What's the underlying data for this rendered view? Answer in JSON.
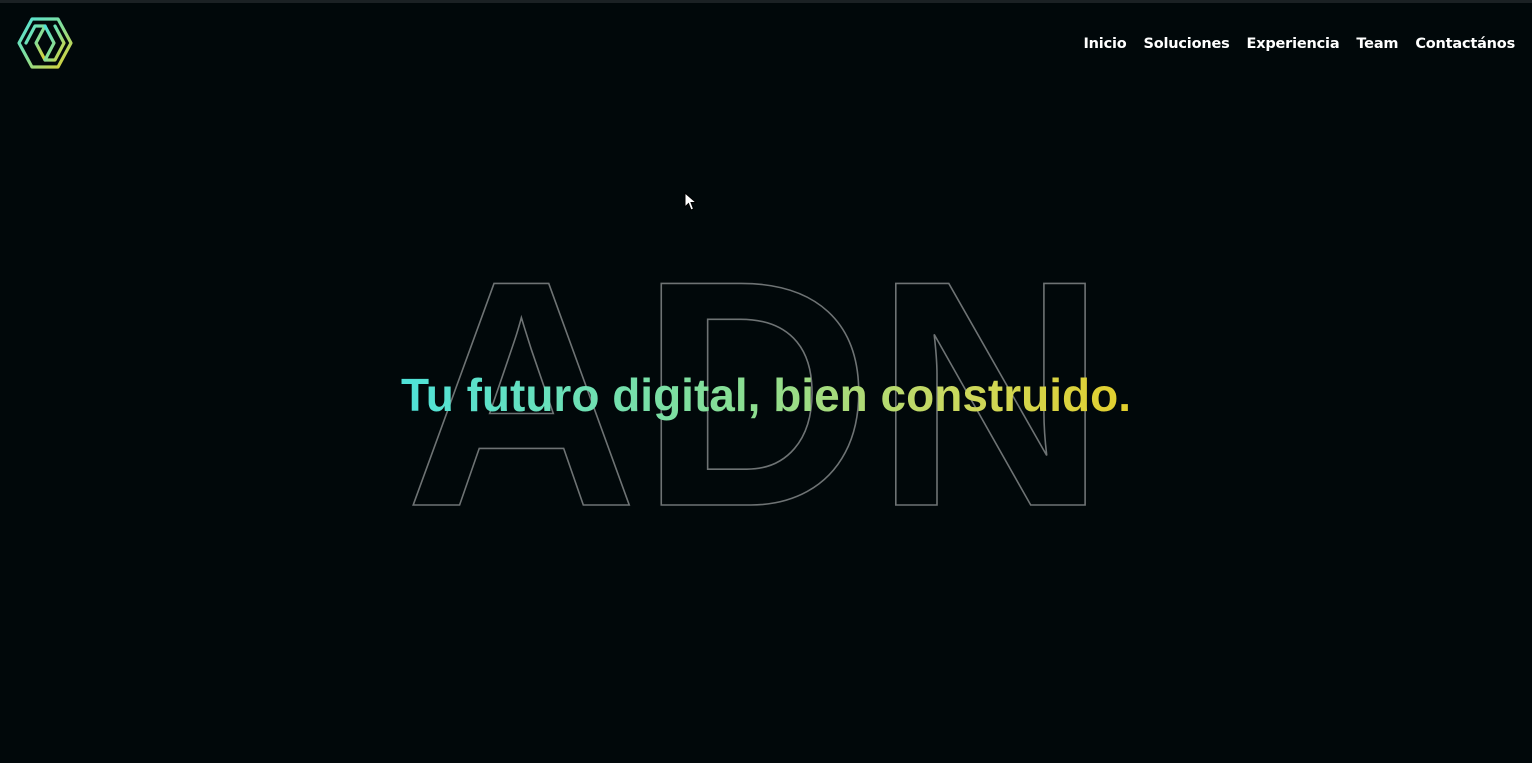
{
  "brand": {
    "logo_icon": "adn-hexagon-logo-icon",
    "gradient_colors": [
      "#4fe2d9",
      "#86de96",
      "#c9d860",
      "#e3cf2c"
    ]
  },
  "nav": {
    "items": [
      {
        "label": "Inicio"
      },
      {
        "label": "Soluciones"
      },
      {
        "label": "Experiencia"
      },
      {
        "label": "Team"
      },
      {
        "label": "Contactános"
      }
    ]
  },
  "hero": {
    "watermark": "ADN",
    "tagline": "Tu futuro digital, bien construido."
  },
  "colors": {
    "background": "#01080a",
    "nav_text": "#ffffff",
    "watermark_stroke": "#6e7374"
  }
}
